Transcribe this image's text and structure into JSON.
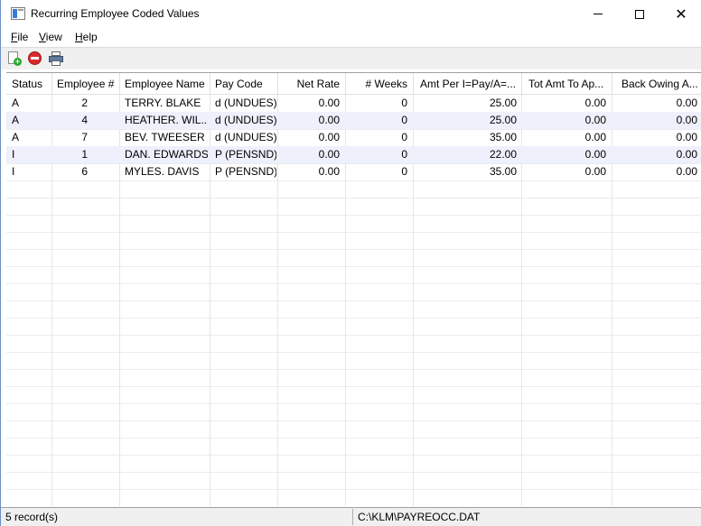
{
  "window": {
    "title": "Recurring Employee Coded Values",
    "icon": "app-window-icon",
    "controls": {
      "minimize": "minimize-icon",
      "maximize": "maximize-icon",
      "close": "✕"
    }
  },
  "menu": [
    {
      "accel": "F",
      "rest": "ile"
    },
    {
      "accel": "V",
      "rest": "iew"
    },
    {
      "accel": "H",
      "rest": "elp"
    }
  ],
  "toolbar": {
    "icons": [
      "new-record-icon",
      "delete-record-icon",
      "print-icon"
    ]
  },
  "table": {
    "columns": [
      "Status",
      "Employee #",
      "Employee Name",
      "Pay Code",
      "Net Rate",
      "# Weeks",
      "Amt Per I=Pay/A=...",
      "Tot Amt To Ap...",
      "Back Owing A..."
    ],
    "rows": [
      [
        "A",
        "2",
        "TERRY. BLAKE",
        "d (UNDUES)",
        "0.00",
        "0",
        "25.00",
        "0.00",
        "0.00"
      ],
      [
        "A",
        "4",
        "HEATHER. WIL...",
        "d (UNDUES)",
        "0.00",
        "0",
        "25.00",
        "0.00",
        "0.00"
      ],
      [
        "A",
        "7",
        "BEV. TWEESER",
        "d (UNDUES)",
        "0.00",
        "0",
        "35.00",
        "0.00",
        "0.00"
      ],
      [
        "I",
        "1",
        "DAN. EDWARDS",
        "P (PENSND)",
        "0.00",
        "0",
        "22.00",
        "0.00",
        "0.00"
      ],
      [
        "I",
        "6",
        "MYLES. DAVIS",
        "P (PENSND)",
        "0.00",
        "0",
        "35.00",
        "0.00",
        "0.00"
      ]
    ]
  },
  "status": {
    "records": "5 record(s)",
    "path": "C:\\KLM\\PAYREOCC.DAT"
  }
}
